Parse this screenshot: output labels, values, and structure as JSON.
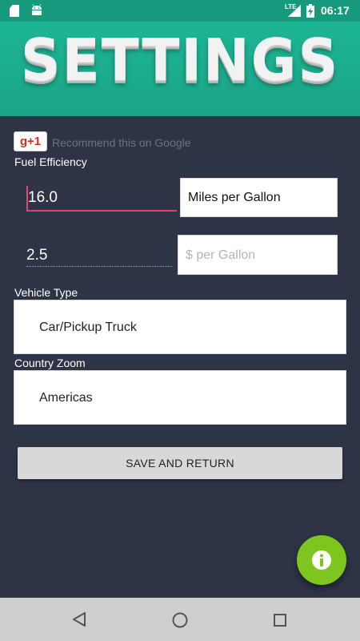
{
  "status_bar": {
    "network": "LTE",
    "time": "06:17"
  },
  "header": {
    "title": "SETTINGS"
  },
  "google_plus": {
    "badge": "g+1",
    "text": "Recommend this on Google"
  },
  "fuel_efficiency": {
    "label": "Fuel Efficiency",
    "value": "16.0",
    "unit": "Miles per Gallon"
  },
  "fuel_price": {
    "value": "2.5",
    "unit_placeholder": "$ per Gallon"
  },
  "vehicle_type": {
    "label": "Vehicle Type",
    "selected": "Car/Pickup Truck"
  },
  "country_zoom": {
    "label": "Country Zoom",
    "selected": "Americas"
  },
  "save_button": {
    "label": "SAVE AND RETURN"
  },
  "colors": {
    "header_green": "#1aa487",
    "background": "#2e3446",
    "accent_pink": "#e0466f",
    "fab_green": "#7ec51e"
  },
  "icons": {
    "fab": "info-icon",
    "nav": [
      "back-icon",
      "home-icon",
      "recents-icon"
    ]
  }
}
